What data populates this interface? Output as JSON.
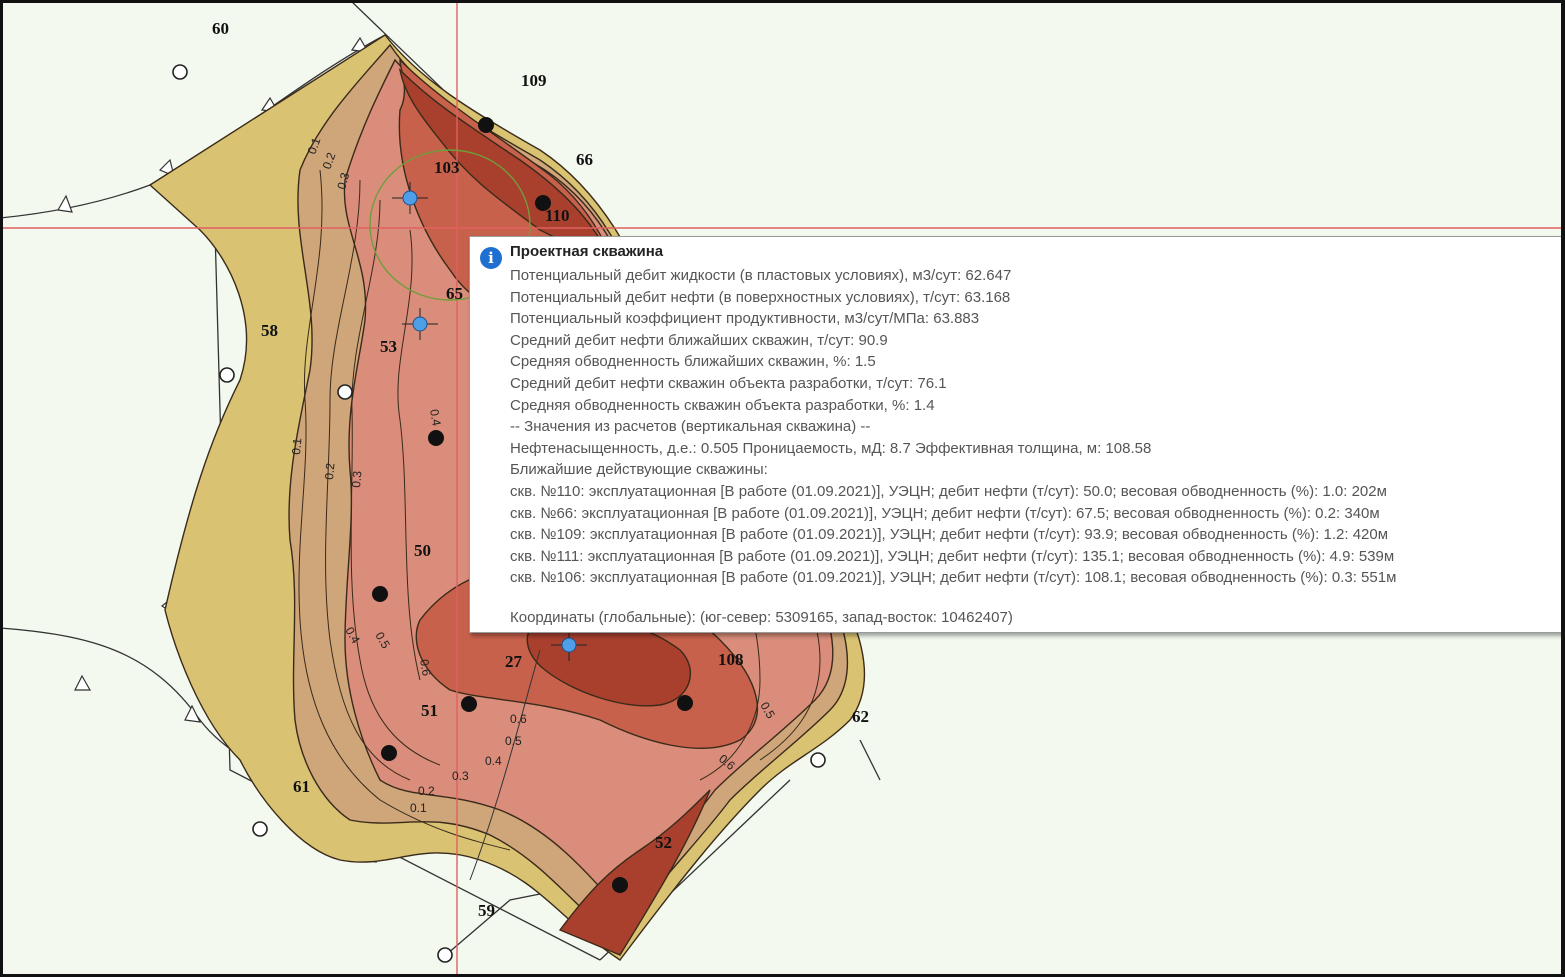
{
  "map": {
    "well_labels": [
      "60",
      "109",
      "66",
      "103",
      "110",
      "58",
      "65",
      "53",
      "50",
      "27",
      "108",
      "51",
      "62",
      "61",
      "52",
      "59"
    ],
    "isoline_labels": [
      "0.1",
      "0.2",
      "0.3",
      "0.4",
      "0.5",
      "0.6"
    ],
    "colors": {
      "outer_zone": "#d9c373",
      "low_zone": "#cfa57a",
      "mid_zone": "#d98d7a",
      "high_zone": "#c7614b",
      "peak_zone": "#a9402e",
      "grid_line": "#e06060",
      "background": "#f3f9ef",
      "projected_well": "#4f9ee8"
    }
  },
  "tooltip": {
    "icon": "info-icon",
    "title": "Проектная скважина",
    "lines": [
      "Потенциальный дебит жидкости (в пластовых условиях), м3/сут: 62.647",
      "Потенциальный дебит нефти (в поверхностных условиях), т/сут: 63.168",
      "Потенциальный коэффициент продуктивности, м3/сут/МПа: 63.883",
      "Средний дебит нефти ближайших скважин, т/сут: 90.9",
      "Средняя обводненность ближайших скважин, %: 1.5",
      "Средний дебит нефти скважин объекта разработки, т/сут: 76.1",
      "Средняя обводненность скважин объекта разработки, %: 1.4",
      "-- Значения из расчетов (вертикальная скважина) --",
      "Нефтенасыщенность, д.е.: 0.505 Проницаемость, мД: 8.7 Эффективная толщина, м: 108.58",
      "Ближайшие действующие скважины:",
      "скв. №110: эксплуатационная [В работе (01.09.2021)], УЭЦН; дебит нефти (т/сут): 50.0; весовая обводненность (%): 1.0: 202м",
      "скв. №66: эксплуатационная [В работе (01.09.2021)], УЭЦН; дебит нефти (т/сут): 67.5; весовая обводненность (%): 0.2: 340м",
      "скв. №109: эксплуатационная [В работе (01.09.2021)], УЭЦН; дебит нефти (т/сут): 93.9; весовая обводненность (%): 1.2: 420м",
      "скв. №111: эксплуатационная [В работе (01.09.2021)], УЭЦН; дебит нефти (т/сут): 135.1; весовая обводненность (%): 4.9: 539м",
      "скв. №106: эксплуатационная [В работе (01.09.2021)], УЭЦН; дебит нефти (т/сут): 108.1; весовая обводненность (%): 0.3: 551м"
    ],
    "coordinates": "Координаты (глобальные): (юг-север: 5309165,  запад-восток: 10462407)"
  }
}
